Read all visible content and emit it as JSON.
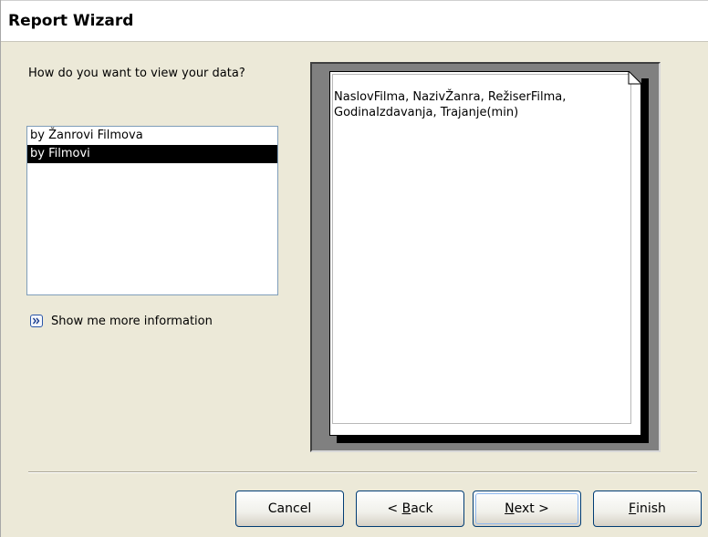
{
  "window": {
    "title": "Report Wizard"
  },
  "left": {
    "prompt": "How do you want to view your data?",
    "view_options": [
      {
        "label": "by Žanrovi Filmova",
        "selected": false
      },
      {
        "label": "by Filmovi",
        "selected": true
      }
    ],
    "more_info": {
      "icon": "double-chevron-right-icon",
      "label": "Show me more information"
    }
  },
  "preview": {
    "fields_text": "NaslovFilma, NazivŽanra, RežiserFilma, GodinaIzdavanja, Trajanje(min)"
  },
  "buttons": {
    "cancel": "Cancel",
    "back": {
      "prefix": "< ",
      "key": "B",
      "rest": "ack"
    },
    "next": {
      "key": "N",
      "rest": "ext >"
    },
    "finish": {
      "key": "F",
      "rest": "inish"
    }
  },
  "colors": {
    "dialog_bg": "#ece9d8",
    "selection_bg": "#000000",
    "button_border": "#003c74",
    "preview_frame": "#808080"
  }
}
